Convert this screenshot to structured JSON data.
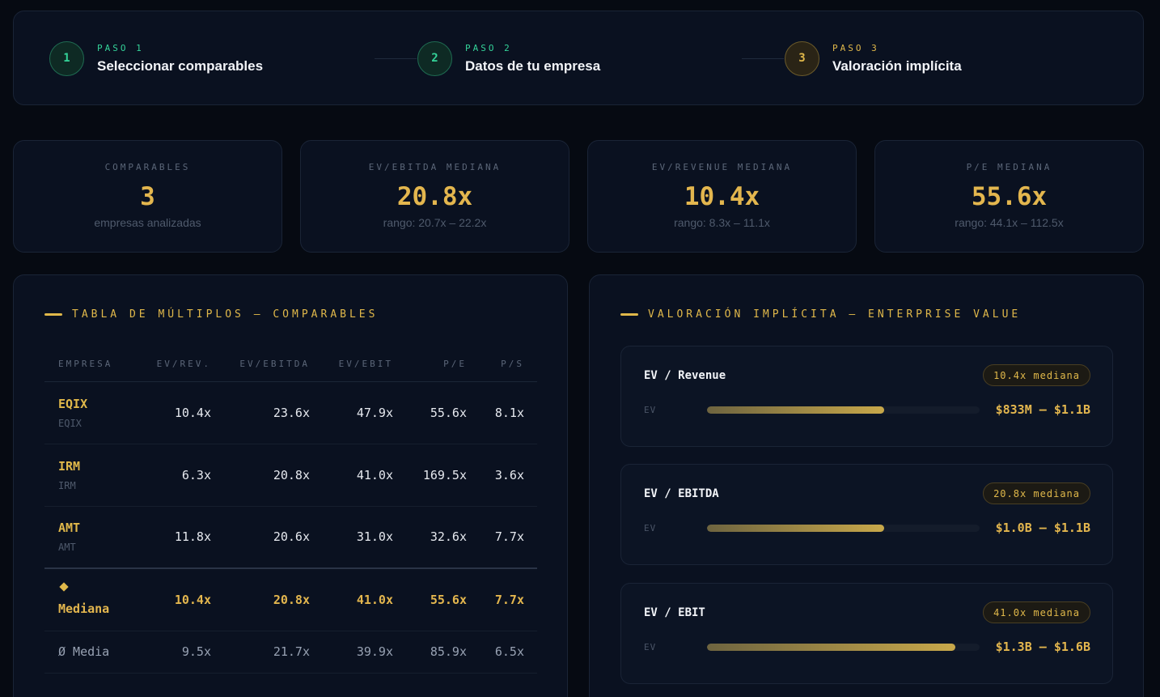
{
  "stepper": {
    "steps": [
      {
        "number": "1",
        "label": "PASO 1",
        "title": "Seleccionar comparables",
        "state": "done"
      },
      {
        "number": "2",
        "label": "PASO 2",
        "title": "Datos de tu empresa",
        "state": "done"
      },
      {
        "number": "3",
        "label": "PASO 3",
        "title": "Valoración implícita",
        "state": "active"
      }
    ]
  },
  "stats": [
    {
      "label": "COMPARABLES",
      "value": "3",
      "sub": "empresas analizadas"
    },
    {
      "label": "EV/EBITDA MEDIANA",
      "value": "20.8x",
      "sub": "rango: 20.7x – 22.2x"
    },
    {
      "label": "EV/REVENUE MEDIANA",
      "value": "10.4x",
      "sub": "rango: 8.3x – 11.1x"
    },
    {
      "label": "P/E MEDIANA",
      "value": "55.6x",
      "sub": "rango: 44.1x – 112.5x"
    }
  ],
  "table": {
    "title": "TABLA DE MÚLTIPLOS — COMPARABLES",
    "headers": [
      "EMPRESA",
      "EV/REV.",
      "EV/EBITDA",
      "EV/EBIT",
      "P/E",
      "P/S"
    ],
    "rows": [
      {
        "ticker": "EQIX",
        "sub": "EQIX",
        "values": [
          "10.4x",
          "23.6x",
          "47.9x",
          "55.6x",
          "8.1x"
        ]
      },
      {
        "ticker": "IRM",
        "sub": "IRM",
        "values": [
          "6.3x",
          "20.8x",
          "41.0x",
          "169.5x",
          "3.6x"
        ]
      },
      {
        "ticker": "AMT",
        "sub": "AMT",
        "values": [
          "11.8x",
          "20.6x",
          "31.0x",
          "32.6x",
          "7.7x"
        ]
      }
    ],
    "median": {
      "label": "Mediana",
      "values": [
        "10.4x",
        "20.8x",
        "41.0x",
        "55.6x",
        "7.7x"
      ]
    },
    "mean": {
      "label": "Ø Media",
      "values": [
        "9.5x",
        "21.7x",
        "39.9x",
        "85.9x",
        "6.5x"
      ]
    }
  },
  "valuation": {
    "title": "VALORACIÓN IMPLÍCITA — ENTERPRISE VALUE",
    "items": [
      {
        "method": "EV / Revenue",
        "badge": "10.4x mediana",
        "ev_label": "EV",
        "range": "$833M – $1.1B",
        "fill_fraction": 0.65
      },
      {
        "method": "EV / EBITDA",
        "badge": "20.8x mediana",
        "ev_label": "EV",
        "range": "$1.0B – $1.1B",
        "fill_fraction": 0.65
      },
      {
        "method": "EV / EBIT",
        "badge": "41.0x mediana",
        "ev_label": "EV",
        "range": "$1.3B – $1.6B",
        "fill_fraction": 0.91
      }
    ]
  },
  "colors": {
    "accent": "#e0b84a",
    "success": "#34d399",
    "background": "#060a12",
    "card": "#0a1120"
  }
}
